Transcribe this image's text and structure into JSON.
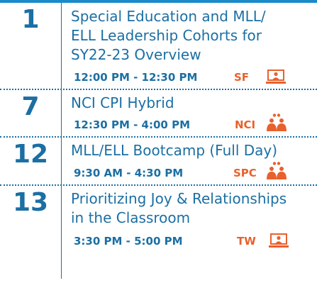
{
  "accent_color": "#1b6fa3",
  "code_color": "#e8612c",
  "events": [
    {
      "day": "1",
      "title_lines": [
        "Special Education and MLL/",
        "ELL Leadership Cohorts for",
        "SY22-23 Overview"
      ],
      "time": "12:00 PM - 12:30 PM",
      "code": "SF",
      "icon": "presentation-icon"
    },
    {
      "day": "7",
      "title_lines": [
        "NCI CPI Hybrid"
      ],
      "time": "12:30 PM - 4:00 PM",
      "code": "NCI",
      "icon": "group-discussion-icon"
    },
    {
      "day": "12",
      "title_lines": [
        "MLL/ELL Bootcamp (Full Day)"
      ],
      "time": "9:30 AM - 4:30 PM",
      "code": "SPC",
      "icon": "group-discussion-icon"
    },
    {
      "day": "13",
      "title_lines": [
        "Prioritizing Joy & Relationships",
        "in the Classroom"
      ],
      "time": "3:30 PM - 5:00 PM",
      "code": "TW",
      "icon": "presentation-icon"
    }
  ]
}
